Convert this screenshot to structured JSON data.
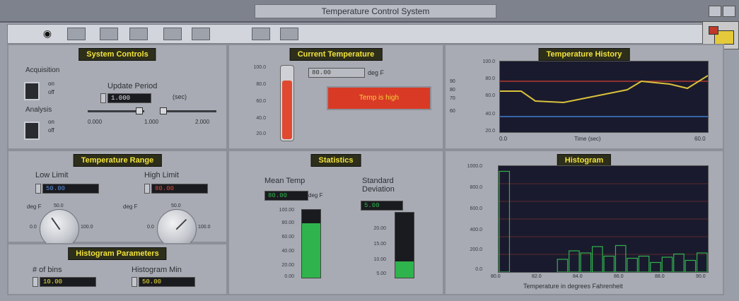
{
  "window": {
    "title": "Temperature Control System"
  },
  "toolbar": {
    "tools": [
      "run",
      "stop",
      "pause",
      "tool-4",
      "tool-5",
      "tool-6",
      "tool-7",
      "tool-8"
    ]
  },
  "system_controls": {
    "title": "System Controls",
    "acquisition": {
      "label": "Acquisition",
      "on": "on",
      "off": "off"
    },
    "analysis": {
      "label": "Analysis",
      "on": "on",
      "off": "off"
    },
    "update_period": {
      "label": "Update Period",
      "value": "1.000",
      "unit": "(sec)"
    },
    "slider_ticks": [
      "0.000",
      "1.000",
      "2.000"
    ]
  },
  "current_temperature": {
    "title": "Current Temperature",
    "readout": "80.00",
    "unit": "deg F",
    "scale": [
      "100.0",
      "80.0",
      "60.0",
      "40.0",
      "20.0"
    ],
    "level_fraction": 0.78,
    "alarm_text": "Temp is high"
  },
  "temperature_history": {
    "title": "Temperature History",
    "y_ticks": [
      "100.0",
      "80.0",
      "60.0",
      "40.0",
      "20.0"
    ],
    "x_label": "Time (sec)",
    "x_start": "0.0",
    "x_end": "60.0",
    "left_ticks": [
      "90",
      "80",
      "70",
      "60"
    ]
  },
  "temperature_range": {
    "title": "Temperature Range",
    "low": {
      "label": "Low Limit",
      "value": "50.00",
      "unit": "deg F"
    },
    "high": {
      "label": "High Limit",
      "value": "80.00",
      "unit": "deg F"
    },
    "knob_ticks": [
      "0.0",
      "50.0",
      "100.0"
    ]
  },
  "statistics": {
    "title": "Statistics",
    "mean": {
      "label": "Mean Temp",
      "value": "80.00",
      "unit": "deg F",
      "level_fraction": 0.8
    },
    "std": {
      "label": "Standard Deviation",
      "value": "5.00",
      "level_fraction": 0.25
    },
    "mean_scale": [
      "100.00",
      "80.00",
      "60.00",
      "40.00",
      "20.00",
      "0.00"
    ],
    "std_scale": [
      "20.00",
      "15.00",
      "10.00",
      "5.00"
    ]
  },
  "histogram_params": {
    "title": "Histogram Parameters",
    "bin_label": "# of bins",
    "bin_value": "10.00",
    "range_label": "Histogram Min",
    "range_value": "50.00"
  },
  "histogram": {
    "title": "Histogram",
    "y_ticks": [
      "1000.0",
      "800.0",
      "600.0",
      "400.0",
      "200.0",
      "0.0"
    ],
    "x_ticks": [
      "80.0",
      "82.0",
      "84.0",
      "86.0",
      "88.0",
      "90.0"
    ],
    "x_label": "Temperature in degrees Fahrenheit",
    "counts": [
      950,
      0,
      0,
      0,
      0,
      120,
      200,
      180,
      240,
      150,
      250,
      130,
      150,
      90,
      140,
      170,
      110,
      180
    ]
  },
  "colors": {
    "accent_yellow": "#f2e33a",
    "alarm_red": "#d93a26",
    "fill_green": "#2fb34c",
    "plot_bg": "#1a1a2e"
  }
}
